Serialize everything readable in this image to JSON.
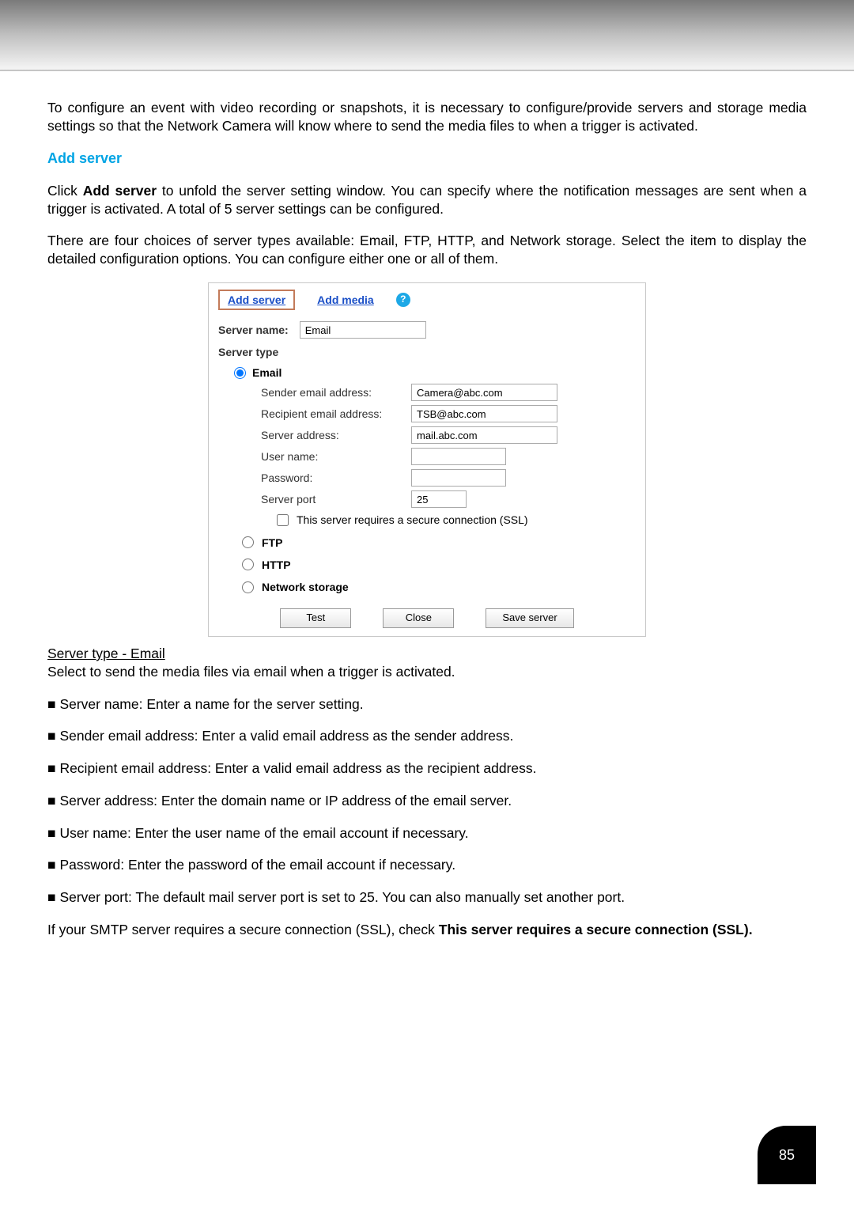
{
  "intro": "To configure an event with video recording or snapshots, it is necessary to configure/provide servers and storage media settings so that the Network Camera will know where to send the media files to when a trigger is activated.",
  "section_title": "Add server",
  "para1_pre": "Click ",
  "para1_bold": "Add server",
  "para1_post": " to unfold the server setting window. You can specify where the notification messages are sent when a trigger is activated. A total of 5 server settings can be configured.",
  "para2": "There are four choices of server types available: Email, FTP, HTTP, and Network storage. Select the item to display the detailed configuration options. You can configure either one or all of them.",
  "panel": {
    "tab_add_server": "Add server",
    "tab_add_media": "Add media",
    "server_name_label": "Server name:",
    "server_name_value": "Email",
    "server_type_label": "Server type",
    "radio_email": "Email",
    "fields": {
      "sender_label": "Sender email address:",
      "sender_value": "Camera@abc.com",
      "recipient_label": "Recipient email address:",
      "recipient_value": "TSB@abc.com",
      "server_addr_label": "Server address:",
      "server_addr_value": "mail.abc.com",
      "username_label": "User name:",
      "username_value": "",
      "password_label": "Password:",
      "password_value": "",
      "port_label": "Server port",
      "port_value": "25"
    },
    "ssl_text": "This server requires a secure connection (SSL)",
    "radio_ftp": "FTP",
    "radio_http": "HTTP",
    "radio_ns": "Network storage",
    "btn_test": "Test",
    "btn_close": "Close",
    "btn_save": "Save server"
  },
  "subheading": "Server type - Email",
  "subdesc": "Select to send the media files via email when a trigger is activated.",
  "bullets": [
    "Server name: Enter a name for the server setting.",
    "Sender email address: Enter a valid email address as the sender address.",
    "Recipient email address: Enter a valid email address as the recipient address.",
    "Server address: Enter the domain name or IP address of the email server.",
    "User name: Enter the user name of the email account if necessary.",
    "Password: Enter the password of the email account if necessary.",
    "Server port: The default mail server port is set to 25. You can also manually set another port."
  ],
  "ssl_note_pre": "If your SMTP server requires a secure connection (SSL), check ",
  "ssl_note_bold": "This server requires a secure connection (SSL).",
  "page_number": "85"
}
